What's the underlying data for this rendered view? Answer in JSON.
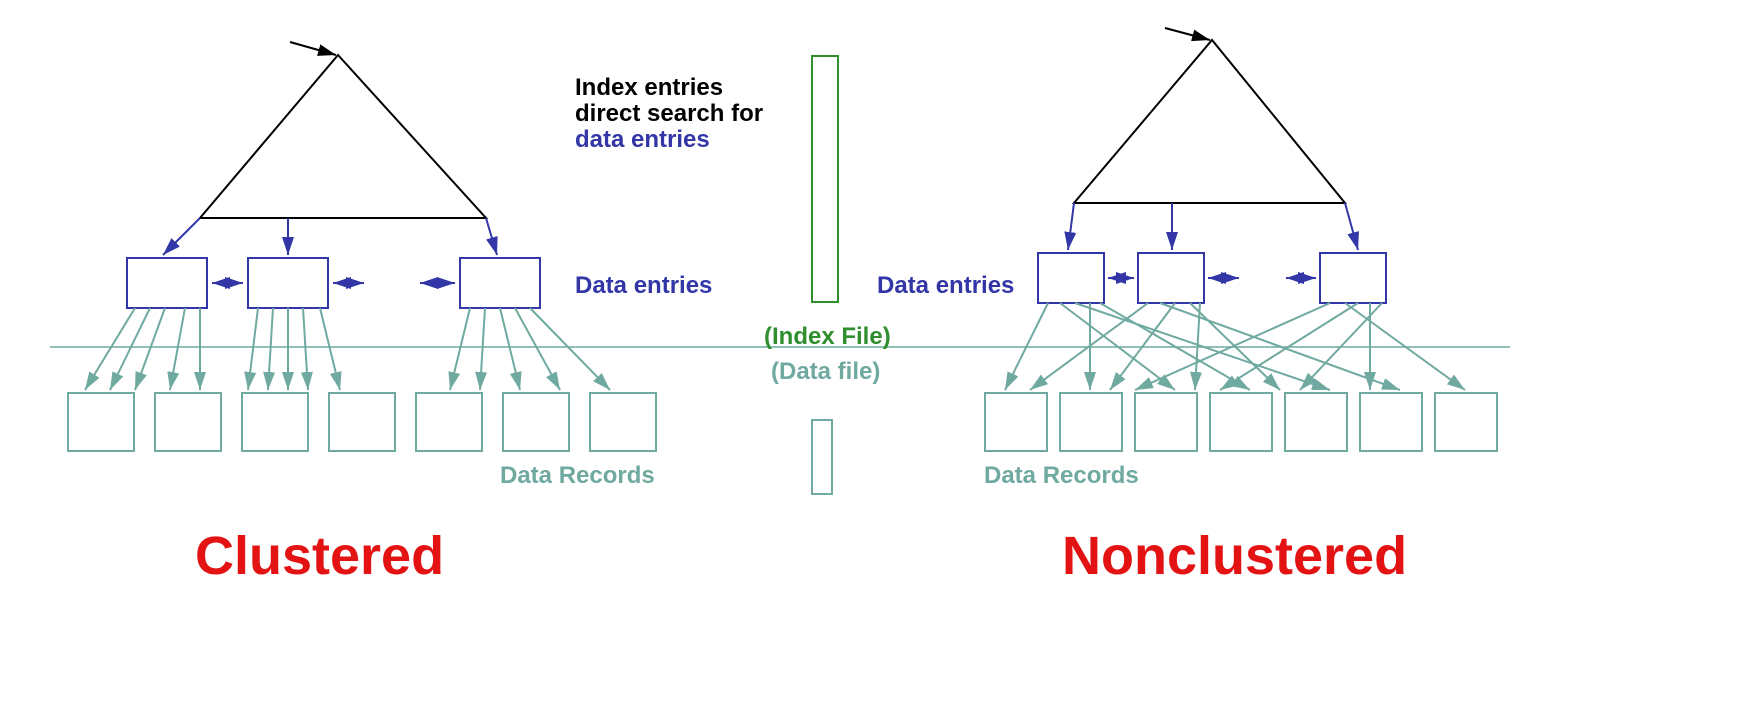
{
  "labels": {
    "index_entries_line1": "Index entries",
    "index_entries_line2": "direct search for",
    "index_entries_line3": "data entries",
    "data_entries_left": "Data entries",
    "data_entries_right": "Data entries",
    "index_file": "(Index File)",
    "data_file": "(Data file)",
    "data_records_left": "Data Records",
    "data_records_right": "Data Records"
  },
  "titles": {
    "clustered": "Clustered",
    "nonclustered": "Nonclustered"
  },
  "colors": {
    "black": "#000000",
    "indigo": "#3236a6",
    "teal": "#6fa9a0",
    "green": "#2f8f2f",
    "red": "#e31313"
  }
}
